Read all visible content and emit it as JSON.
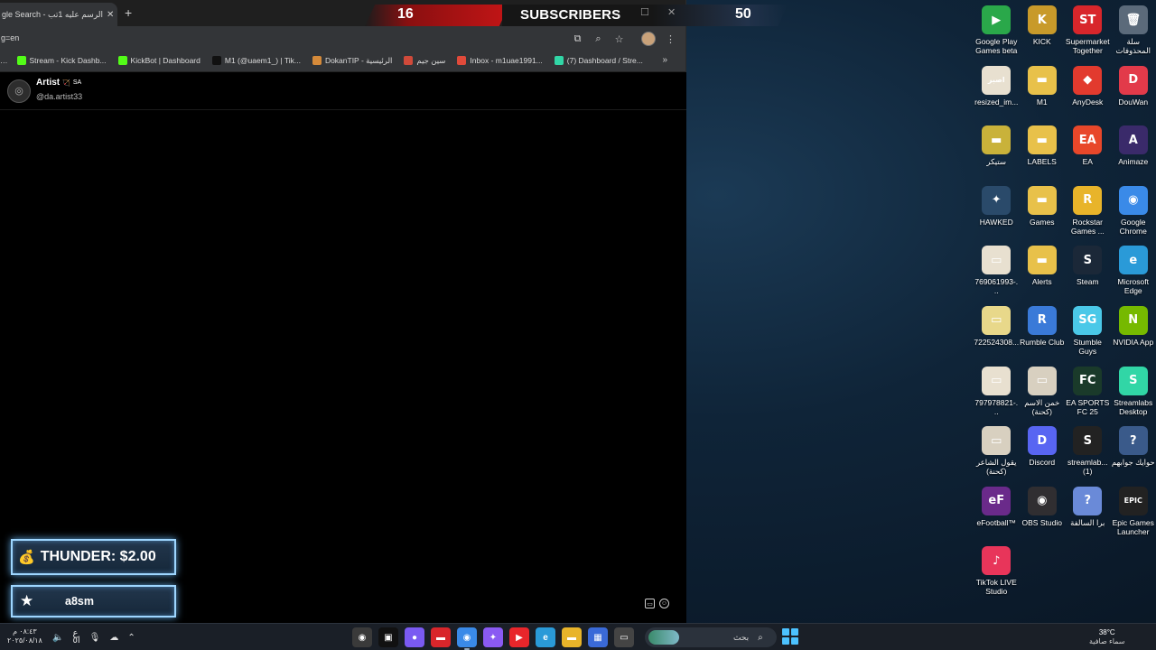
{
  "browser": {
    "tab_title": "gle Search - هل الرسم عليه 1تب",
    "tab_close": "✕",
    "new_tab": "+",
    "url": "g=en",
    "bookmarks": [
      {
        "label": "Stream - Kick Dashb...",
        "color": "#53fc18"
      },
      {
        "label": "KickBot | Dashboard",
        "color": "#53fc18"
      },
      {
        "label": "M1 (@uaem1_) | Tik...",
        "color": "#111111"
      },
      {
        "label": "DokanTIP - الرئيسية",
        "color": "#d58a3a"
      },
      {
        "label": "سين جيم",
        "color": "#d04a3a"
      },
      {
        "label": "Inbox - m1uae1991...",
        "color": "#e04a3a"
      },
      {
        "label": "(7) Dashboard / Stre...",
        "color": "#31d6a6"
      }
    ],
    "bookmarks_more": "»"
  },
  "overlay": {
    "left_count": "16",
    "title": "SUBSCRIBERS",
    "right_count": "50"
  },
  "profile": {
    "name": "Artist",
    "badge": "SA",
    "handle": "@da.artist33"
  },
  "alerts": {
    "donation": "THUNDER: $2.00",
    "follower": "a8sm"
  },
  "desktop_icons": [
    {
      "label": "Google Play Games beta",
      "color": "#2aa84a",
      "glyph": "▶"
    },
    {
      "label": "KICK",
      "color": "#c89a2a",
      "glyph": "K"
    },
    {
      "label": "Supermarket Together",
      "color": "#d8262b",
      "glyph": "ST"
    },
    {
      "label": "سلة المحذوفات",
      "color": "#5b6a7a",
      "glyph": "🗑"
    },
    {
      "label": "resized_im...",
      "color": "#e8e0d0",
      "glyph": "اصبر"
    },
    {
      "label": "M1",
      "color": "#e8c14a",
      "glyph": "▬"
    },
    {
      "label": "AnyDesk",
      "color": "#e23a2e",
      "glyph": "◆"
    },
    {
      "label": "DouWan",
      "color": "#e23a4a",
      "glyph": "D"
    },
    {
      "label": "ستيكر",
      "color": "#c9b23a",
      "glyph": "▬"
    },
    {
      "label": "LABELS",
      "color": "#e8c14a",
      "glyph": "▬"
    },
    {
      "label": "EA",
      "color": "#e8472a",
      "glyph": "EA"
    },
    {
      "label": "Animaze",
      "color": "#3a2a6a",
      "glyph": "A"
    },
    {
      "label": "HAWKED",
      "color": "#2a4a6a",
      "glyph": "✦"
    },
    {
      "label": "Games",
      "color": "#e8c14a",
      "glyph": "▬"
    },
    {
      "label": "Rockstar Games ...",
      "color": "#e8b42a",
      "glyph": "R"
    },
    {
      "label": "Google Chrome",
      "color": "#3a8ae8",
      "glyph": "◉"
    },
    {
      "label": "769061993-...",
      "color": "#e8e0d0",
      "glyph": "▭"
    },
    {
      "label": "Alerts",
      "color": "#e8c14a",
      "glyph": "▬"
    },
    {
      "label": "Steam",
      "color": "#1b2838",
      "glyph": "S"
    },
    {
      "label": "Microsoft Edge",
      "color": "#2a9ad8",
      "glyph": "e"
    },
    {
      "label": "722524308...",
      "color": "#e8d88a",
      "glyph": "▭"
    },
    {
      "label": "Rumble Club",
      "color": "#3a7ad8",
      "glyph": "R"
    },
    {
      "label": "Stumble Guys",
      "color": "#4ac8e8",
      "glyph": "SG"
    },
    {
      "label": "NVIDIA App",
      "color": "#76b900",
      "glyph": "N"
    },
    {
      "label": "797978821-...",
      "color": "#e8e0d0",
      "glyph": "▭"
    },
    {
      "label": "خمن الاسم (كحنة)",
      "color": "#d8d0c0",
      "glyph": "▭"
    },
    {
      "label": "EA SPORTS FC 25",
      "color": "#1a3a2a",
      "glyph": "FC"
    },
    {
      "label": "Streamlabs Desktop",
      "color": "#31d6a6",
      "glyph": "S"
    },
    {
      "label": "يقول الشاعر (كحنة)",
      "color": "#d8d0c0",
      "glyph": "▭"
    },
    {
      "label": "Discord",
      "color": "#5865f2",
      "glyph": "D"
    },
    {
      "label": "streamlab... (1)",
      "color": "#222222",
      "glyph": "S"
    },
    {
      "label": "حوايك جوابهم",
      "color": "#3a5a8a",
      "glyph": "?"
    },
    {
      "label": "eFootball™",
      "color": "#6a2a8a",
      "glyph": "eF"
    },
    {
      "label": "OBS Studio",
      "color": "#302e31",
      "glyph": "◉"
    },
    {
      "label": "برا السالفة",
      "color": "#6a8ad8",
      "glyph": "?"
    },
    {
      "label": "Epic Games Launcher",
      "color": "#222222",
      "glyph": "EPIC"
    },
    {
      "label": "TikTok LIVE Studio",
      "color": "#e8355a",
      "glyph": "♪"
    }
  ],
  "taskbar": {
    "time": "٠٨:٤٣ م",
    "date": "٢٠٢٥/٠٨/١٨",
    "lang_top": "ع",
    "lang_bottom": "ا٥",
    "search_text": "بحث",
    "weather_temp": "38°C",
    "weather_desc": "سماء صافية",
    "pinned": [
      {
        "name": "recorder",
        "color": "#3a3a3a",
        "glyph": "◉"
      },
      {
        "name": "capcut",
        "color": "#111111",
        "glyph": "▣"
      },
      {
        "name": "discord-bot",
        "color": "#7a5af2",
        "glyph": "●"
      },
      {
        "name": "deal-app",
        "color": "#d8262b",
        "glyph": "▬"
      },
      {
        "name": "chrome",
        "color": "#3a8ae8",
        "glyph": "◉"
      },
      {
        "name": "copilot",
        "color": "#8a5af2",
        "glyph": "✦"
      },
      {
        "name": "youtube",
        "color": "#e8262b",
        "glyph": "▶"
      },
      {
        "name": "edge",
        "color": "#2a9ad8",
        "glyph": "e"
      },
      {
        "name": "explorer",
        "color": "#e8b42a",
        "glyph": "▬"
      },
      {
        "name": "store",
        "color": "#3a6ad8",
        "glyph": "▦"
      },
      {
        "name": "monitor",
        "color": "#444444",
        "glyph": "▭"
      }
    ]
  }
}
